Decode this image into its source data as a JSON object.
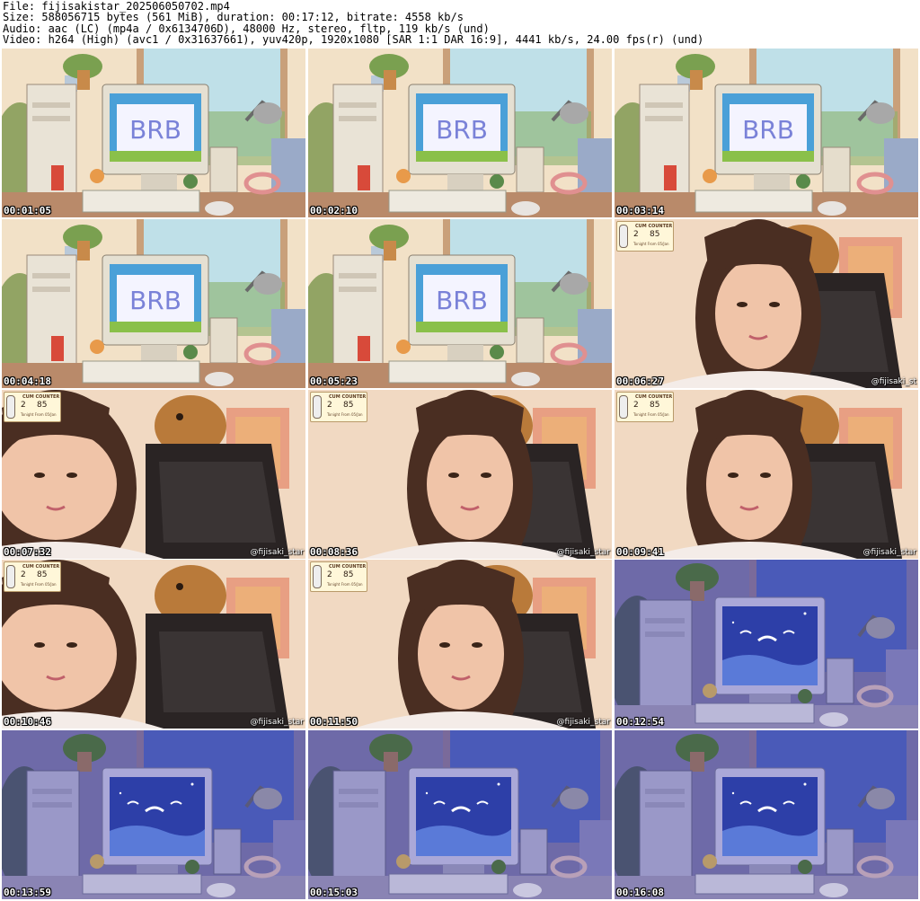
{
  "header": {
    "file_line": "File: fijisakistar_202506050702.mp4",
    "size_line": "Size: 588056715 bytes (561 MiB), duration: 00:17:12, bitrate: 4558 kb/s",
    "audio_line": "Audio: aac (LC) (mp4a / 0x6134706D), 48000 Hz, stereo, fltp, 119 kb/s (und)",
    "video_line": "Video: h264 (High) (avc1 / 0x31637661), yuv420p, 1920x1080 [SAR 1:1 DAR 16:9], 4441 kb/s, 24.00 fps(r) (und)"
  },
  "counter": {
    "title": "CUM COUNTER",
    "value_left": "2",
    "value_right": "85",
    "subtitle": "Tonight   From 05/Jan"
  },
  "thumbnails": [
    {
      "timestamp": "00:01:05",
      "scene": "brb",
      "watermark": ""
    },
    {
      "timestamp": "00:02:10",
      "scene": "brb",
      "watermark": ""
    },
    {
      "timestamp": "00:03:14",
      "scene": "brb",
      "watermark": ""
    },
    {
      "timestamp": "00:04:18",
      "scene": "brb",
      "watermark": ""
    },
    {
      "timestamp": "00:05:23",
      "scene": "brb",
      "watermark": ""
    },
    {
      "timestamp": "00:06:27",
      "scene": "cam",
      "watermark": "@fijisaki_st"
    },
    {
      "timestamp": "00:07:32",
      "scene": "cam",
      "watermark": "@fijisaki_star"
    },
    {
      "timestamp": "00:08:36",
      "scene": "cam",
      "watermark": "@fijisaki_star"
    },
    {
      "timestamp": "00:09:41",
      "scene": "cam",
      "watermark": "@fijisaki_star"
    },
    {
      "timestamp": "00:10:46",
      "scene": "cam",
      "watermark": "@fijisaki_star"
    },
    {
      "timestamp": "00:11:50",
      "scene": "cam",
      "watermark": "@fijisaki_star"
    },
    {
      "timestamp": "00:12:54",
      "scene": "night",
      "watermark": ""
    },
    {
      "timestamp": "00:13:59",
      "scene": "night",
      "watermark": ""
    },
    {
      "timestamp": "00:15:03",
      "scene": "night",
      "watermark": ""
    },
    {
      "timestamp": "00:16:08",
      "scene": "night",
      "watermark": ""
    }
  ],
  "brb_label": "BRB",
  "colors": {
    "brb_wall": "#f2e1c7",
    "brb_window": "#bfe0e8",
    "brb_desk": "#b98a6a",
    "brb_screen": "#f4f4ff",
    "brb_text": "#7a82d8",
    "night_wall": "#6e6aa8",
    "night_screen": "#2d3fa8",
    "cam_bg": "#f1d9c2",
    "hair": "#4a2e22",
    "skin": "#f0c4a8",
    "chair": "#2a2424",
    "plush": "#b97a3a"
  }
}
